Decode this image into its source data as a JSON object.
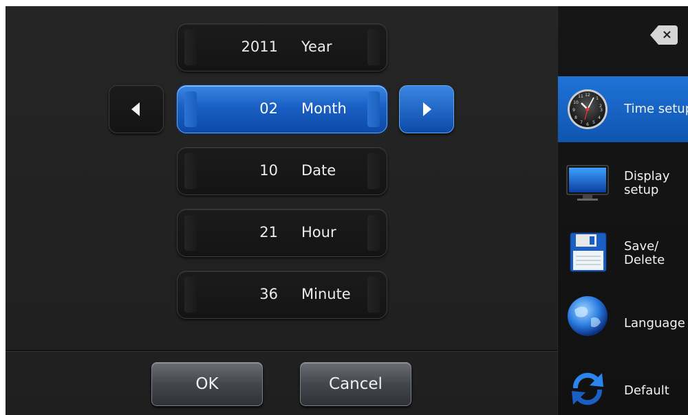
{
  "fields": [
    {
      "value": "2011",
      "unit": "Year"
    },
    {
      "value": "02",
      "unit": "Month"
    },
    {
      "value": "10",
      "unit": "Date"
    },
    {
      "value": "21",
      "unit": "Hour"
    },
    {
      "value": "36",
      "unit": "Minute"
    }
  ],
  "buttons": {
    "ok": "OK",
    "cancel": "Cancel"
  },
  "close_glyph": "×",
  "sidebar": {
    "items": [
      {
        "label": "Time setup",
        "icon": "clock-icon"
      },
      {
        "label_line1": "Display",
        "label_line2": "setup",
        "icon": "monitor-icon"
      },
      {
        "label_line1": "Save/",
        "label_line2": "Delete",
        "icon": "floppy-disk-icon"
      },
      {
        "label": "Language",
        "icon": "globe-icon"
      },
      {
        "label": "Default",
        "icon": "refresh-icon"
      }
    ]
  },
  "colors": {
    "accent": "#1a5fc4",
    "background": "#1e1e1e"
  }
}
